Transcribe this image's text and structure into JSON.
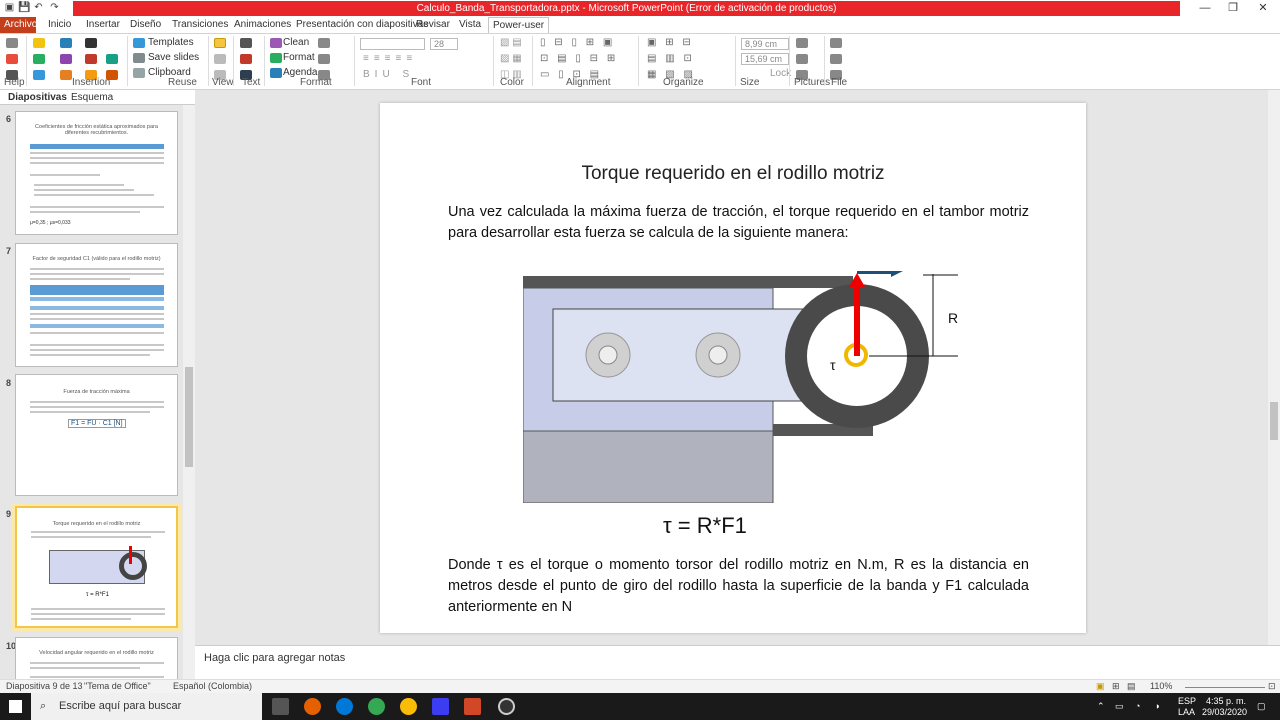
{
  "window": {
    "title": "Calculo_Banda_Transportadora.pptx  -  Microsoft PowerPoint (Error de activación de productos)",
    "controls": [
      "—",
      "❐",
      "✕"
    ]
  },
  "tabs": [
    "Archivo",
    "Inicio",
    "Insertar",
    "Diseño",
    "Transiciones",
    "Animaciones",
    "Presentación con diapositivas",
    "Revisar",
    "Vista",
    "Power-user"
  ],
  "ribbon": {
    "groups": [
      "Help",
      "Insertion",
      "Reuse",
      "View",
      "Text",
      "Format",
      "Font",
      "Color",
      "Alignment",
      "Organize",
      "Size",
      "Pictures",
      "File"
    ],
    "buttons": {
      "templates": "Templates",
      "save_slides": "Save slides",
      "clipboard": "Clipboard",
      "clean": "Clean",
      "format": "Format",
      "agenda": "Agenda",
      "lock": "Lock"
    },
    "font_size": "28",
    "width": "8,99 cm",
    "height": "15,69 cm"
  },
  "panel": {
    "tabs": [
      "Diapositivas",
      "Esquema"
    ]
  },
  "thumbs": [
    {
      "num": "6",
      "title": "Coeficientes de fricción estática aproximados para diferentes recubrimientos.",
      "footer": "μ=0,35 ; μs=0,033"
    },
    {
      "num": "7",
      "title": "Factor de seguridad C1 (válido para el rodillo motriz)"
    },
    {
      "num": "8",
      "title": "Fuerza de tracción máxima",
      "formula": "F1 = FU · C1  [N]"
    },
    {
      "num": "9",
      "title": "Torque requerido en el rodillo motriz",
      "formula": "τ = R*F1"
    },
    {
      "num": "10",
      "title": "Velocidad angular requerido en el rodillo motriz"
    }
  ],
  "slide": {
    "title": "Torque requerido en el rodillo motriz",
    "p1": "Una vez calculada la máxima fuerza de tracción, el torque requerido en el tambor motriz para desarrollar esta fuerza se calcula de la siguiente manera:",
    "formula": "τ = R*F1",
    "p2": "Donde τ es el torque o momento torsor del rodillo motriz en N.m, R es la distancia en metros desde el punto de giro del rodillo hasta la superficie de la banda y F1 calculada anteriormente en N",
    "diagram": {
      "label_f": "F",
      "label_f_sub": "1",
      "label_r": "R",
      "label_tau": "τ"
    }
  },
  "notes": {
    "placeholder": "Haga clic para agregar notas"
  },
  "status": {
    "slide": "Diapositiva 9 de 13",
    "theme": "\"Tema de Office\"",
    "language": "Español (Colombia)",
    "zoom": "110%"
  },
  "taskbar": {
    "search": "Escribe aquí para buscar",
    "lang1": "ESP",
    "lang2": "LAA",
    "time": "4:35 p. m.",
    "date": "29/03/2020"
  }
}
